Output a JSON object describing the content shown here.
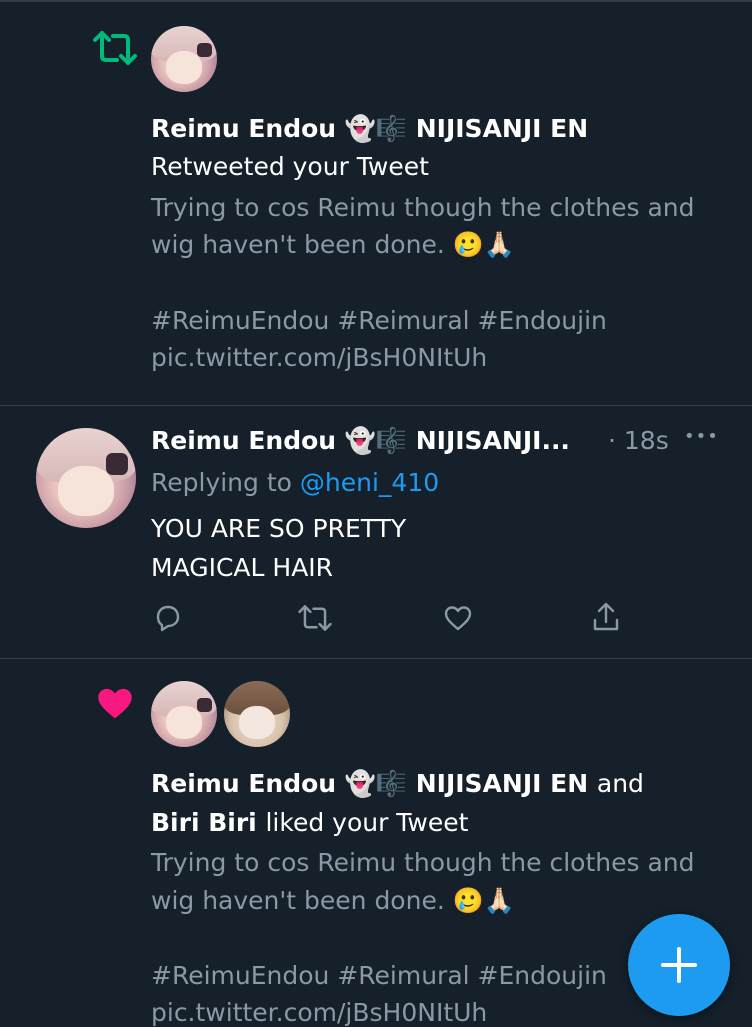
{
  "notifications": [
    {
      "type": "retweet",
      "actor_name": "Reimu Endou 👻🎼 NIJISANJI EN",
      "action": "Retweeted your Tweet",
      "tweet_line1": "Trying to cos Reimu though the clothes and",
      "tweet_line2": "wig haven't been done. 🥲🙏🏻",
      "hashtags": "#ReimuEndou #Reimural #Endoujin",
      "pic_link": "pic.twitter.com/jBsH0NItUh",
      "icon": "retweet-icon",
      "icon_color": "#00ba7c"
    },
    {
      "type": "reply",
      "actor_name": "Reimu Endou 👻🎼 NIJISANJI...",
      "timestamp": "· 18s",
      "more": "•••",
      "replying_prefix": "Replying to",
      "replying_handle": "@heni_410",
      "text_line1": "YOU ARE SO PRETTY",
      "text_line2": "MAGICAL HAIR",
      "actions": [
        "reply-icon",
        "retweet-icon",
        "like-icon",
        "share-icon"
      ]
    },
    {
      "type": "like",
      "actor_name": "Reimu Endou 👻🎼 NIJISANJI EN",
      "and_text": "and",
      "actor2_name": "Biri Biri",
      "action": "liked your Tweet",
      "tweet_line1": "Trying to cos Reimu though the clothes and",
      "tweet_line2": "wig haven't been done. 🥲🙏🏻",
      "hashtags": "#ReimuEndou #Reimural #Endoujin",
      "pic_link": "pic.twitter.com/jBsH0NItUh",
      "icon": "heart-icon",
      "icon_color": "#f91880"
    }
  ],
  "fab": {
    "icon": "plus-icon",
    "color": "#1d9bf0"
  },
  "colors": {
    "background": "#15202b",
    "muted": "#8b98a5",
    "link": "#1d9bf0",
    "divider": "#38444d"
  }
}
